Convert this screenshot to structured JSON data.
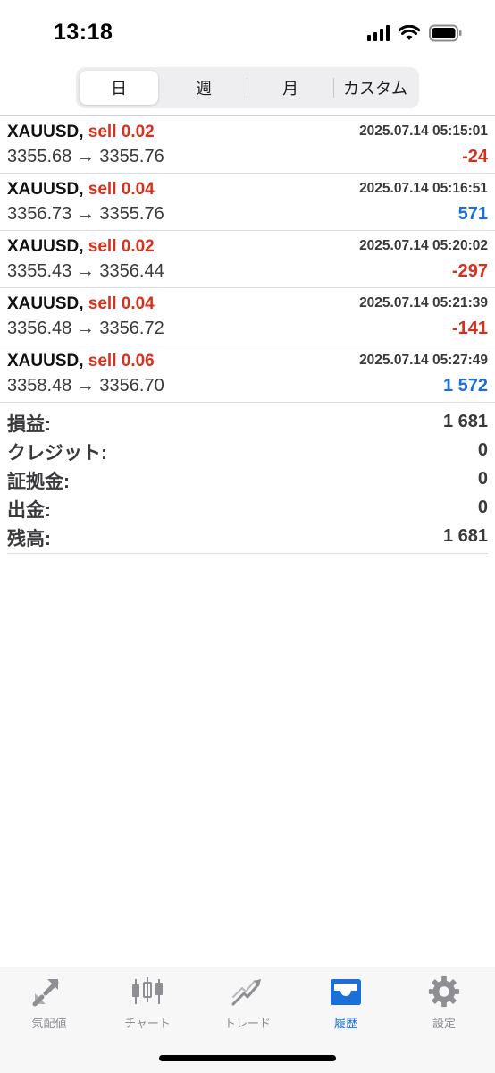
{
  "status": {
    "time": "13:18"
  },
  "periods": [
    {
      "label": "日",
      "active": true
    },
    {
      "label": "週",
      "active": false
    },
    {
      "label": "月",
      "active": false
    },
    {
      "label": "カスタム",
      "active": false
    }
  ],
  "deals": [
    {
      "symbol": "XAUUSD,",
      "type": "sell 0.02",
      "time": "2025.07.14 05:15:01",
      "prices": "3355.68 → 3355.76",
      "pnl": "-24",
      "pnl_sign": "neg"
    },
    {
      "symbol": "XAUUSD,",
      "type": "sell 0.04",
      "time": "2025.07.14 05:16:51",
      "prices": "3356.73 → 3355.76",
      "pnl": "571",
      "pnl_sign": "pos"
    },
    {
      "symbol": "XAUUSD,",
      "type": "sell 0.02",
      "time": "2025.07.14 05:20:02",
      "prices": "3355.43 → 3356.44",
      "pnl": "-297",
      "pnl_sign": "neg"
    },
    {
      "symbol": "XAUUSD,",
      "type": "sell 0.04",
      "time": "2025.07.14 05:21:39",
      "prices": "3356.48 → 3356.72",
      "pnl": "-141",
      "pnl_sign": "neg"
    },
    {
      "symbol": "XAUUSD,",
      "type": "sell 0.06",
      "time": "2025.07.14 05:27:49",
      "prices": "3358.48 → 3356.70",
      "pnl": "1 572",
      "pnl_sign": "pos"
    }
  ],
  "summary": {
    "profit_label": "損益:",
    "profit_value": "1 681",
    "credit_label": "クレジット:",
    "credit_value": "0",
    "deposit_label": "証拠金:",
    "deposit_value": "0",
    "withdrawal_label": "出金:",
    "withdrawal_value": "0",
    "balance_label": "残高:",
    "balance_value": "1 681"
  },
  "tabs": {
    "quotes": {
      "label": "気配値",
      "icon": "quotes-arrows-icon"
    },
    "chart": {
      "label": "チャート",
      "icon": "candlestick-icon"
    },
    "trade": {
      "label": "トレード",
      "icon": "trade-chart-icon"
    },
    "history": {
      "label": "履歴",
      "icon": "inbox-tray-icon",
      "active": true
    },
    "settings": {
      "label": "設定",
      "icon": "gear-icon"
    }
  },
  "colors": {
    "accent": "#1a6fd8",
    "loss": "#d9301c",
    "inactive_tab": "#8e8e93"
  }
}
